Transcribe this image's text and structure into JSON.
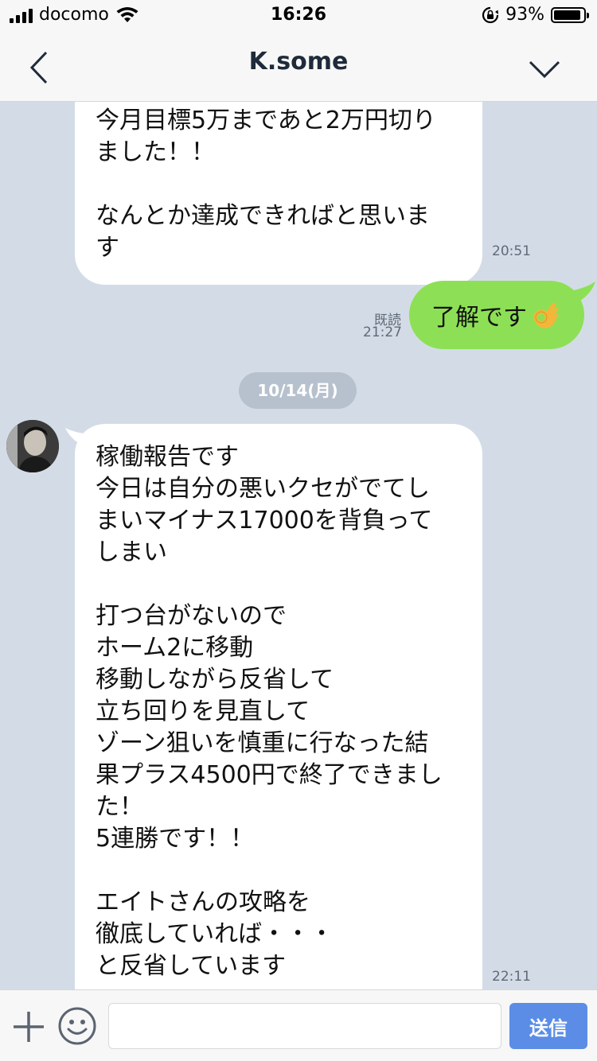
{
  "status_bar": {
    "carrier": "docomo",
    "time": "16:26",
    "battery_percent": "93%",
    "battery_level": 0.93
  },
  "header": {
    "title": "K.some"
  },
  "messages": [
    {
      "direction": "incoming",
      "text": "今月目標5万まであと2万円切り\nました！！\n\nなんとか達成できればと思いま\nす",
      "time": "20:51"
    },
    {
      "direction": "outgoing",
      "text": "了解です",
      "emoji": "ok-hand-emoji",
      "read_label": "既読",
      "time": "21:27"
    },
    {
      "date_separator": "10/14(月)"
    },
    {
      "direction": "incoming",
      "text": "稼働報告です\n今日は自分の悪いクセがでてし\nまいマイナス17000を背負って\nしまい\n\n打つ台がないので\nホーム2に移動\n移動しながら反省して\n立ち回りを見直して\nゾーン狙いを慎重に行なった結\n果プラス4500円で終了できまし\nた！\n5連勝です！！\n\nエイトさんの攻略を\n徹底していれば・・・\nと反省しています",
      "time": "22:11"
    }
  ],
  "input_bar": {
    "placeholder": "",
    "send_label": "送信"
  },
  "colors": {
    "chat_background": "#d3dce6",
    "outgoing_bubble": "#8de055",
    "send_button": "#5b8de6"
  }
}
